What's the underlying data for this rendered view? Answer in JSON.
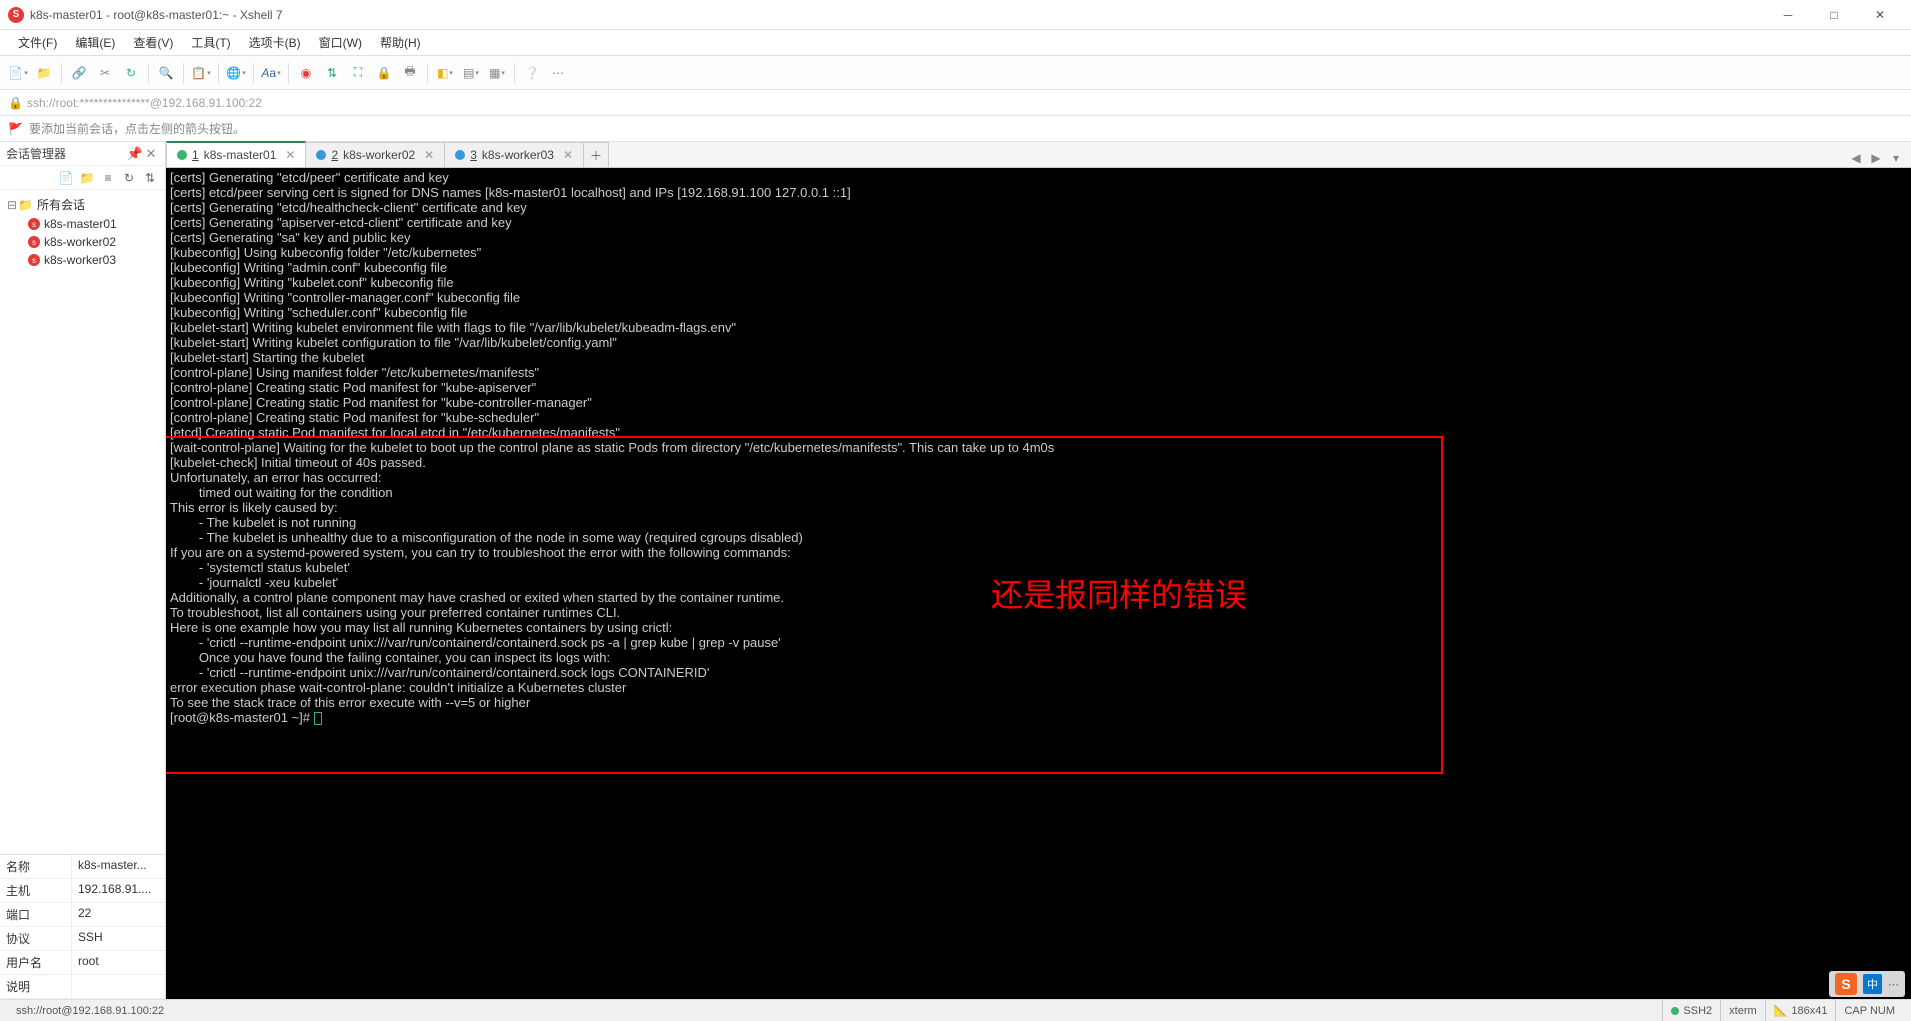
{
  "window": {
    "title": "k8s-master01 - root@k8s-master01:~ - Xshell 7"
  },
  "menu": [
    "文件(F)",
    "编辑(E)",
    "查看(V)",
    "工具(T)",
    "选项卡(B)",
    "窗口(W)",
    "帮助(H)"
  ],
  "address": "ssh://root:***************@192.168.91.100:22",
  "hint": "要添加当前会话，点击左侧的箭头按钮。",
  "sidebar": {
    "title": "会话管理器",
    "root": "所有会话",
    "items": [
      {
        "label": "k8s-master01"
      },
      {
        "label": "k8s-worker02"
      },
      {
        "label": "k8s-worker03"
      }
    ]
  },
  "props": [
    {
      "key": "名称",
      "val": "k8s-master..."
    },
    {
      "key": "主机",
      "val": "192.168.91...."
    },
    {
      "key": "端口",
      "val": "22"
    },
    {
      "key": "协议",
      "val": "SSH"
    },
    {
      "key": "用户名",
      "val": "root"
    },
    {
      "key": "说明",
      "val": ""
    }
  ],
  "tabs": [
    {
      "num": "1",
      "label": "k8s-master01",
      "active": true,
      "status": "green"
    },
    {
      "num": "2",
      "label": "k8s-worker02",
      "active": false,
      "status": "blue"
    },
    {
      "num": "3",
      "label": "k8s-worker03",
      "active": false,
      "status": "blue"
    }
  ],
  "annotation": "还是报同样的错误",
  "terminal": {
    "lines": [
      "[certs] Generating \"etcd/peer\" certificate and key",
      "[certs] etcd/peer serving cert is signed for DNS names [k8s-master01 localhost] and IPs [192.168.91.100 127.0.0.1 ::1]",
      "[certs] Generating \"etcd/healthcheck-client\" certificate and key",
      "[certs] Generating \"apiserver-etcd-client\" certificate and key",
      "[certs] Generating \"sa\" key and public key",
      "[kubeconfig] Using kubeconfig folder \"/etc/kubernetes\"",
      "[kubeconfig] Writing \"admin.conf\" kubeconfig file",
      "[kubeconfig] Writing \"kubelet.conf\" kubeconfig file",
      "[kubeconfig] Writing \"controller-manager.conf\" kubeconfig file",
      "[kubeconfig] Writing \"scheduler.conf\" kubeconfig file",
      "[kubelet-start] Writing kubelet environment file with flags to file \"/var/lib/kubelet/kubeadm-flags.env\"",
      "[kubelet-start] Writing kubelet configuration to file \"/var/lib/kubelet/config.yaml\"",
      "[kubelet-start] Starting the kubelet",
      "[control-plane] Using manifest folder \"/etc/kubernetes/manifests\"",
      "[control-plane] Creating static Pod manifest for \"kube-apiserver\"",
      "[control-plane] Creating static Pod manifest for \"kube-controller-manager\"",
      "[control-plane] Creating static Pod manifest for \"kube-scheduler\"",
      "[etcd] Creating static Pod manifest for local etcd in \"/etc/kubernetes/manifests\"",
      "[wait-control-plane] Waiting for the kubelet to boot up the control plane as static Pods from directory \"/etc/kubernetes/manifests\". This can take up to 4m0s",
      "[kubelet-check] Initial timeout of 40s passed.",
      "",
      "Unfortunately, an error has occurred:",
      "        timed out waiting for the condition",
      "",
      "This error is likely caused by:",
      "        - The kubelet is not running",
      "        - The kubelet is unhealthy due to a misconfiguration of the node in some way (required cgroups disabled)",
      "",
      "If you are on a systemd-powered system, you can try to troubleshoot the error with the following commands:",
      "        - 'systemctl status kubelet'",
      "        - 'journalctl -xeu kubelet'",
      "",
      "Additionally, a control plane component may have crashed or exited when started by the container runtime.",
      "To troubleshoot, list all containers using your preferred container runtimes CLI.",
      "Here is one example how you may list all running Kubernetes containers by using crictl:",
      "        - 'crictl --runtime-endpoint unix:///var/run/containerd/containerd.sock ps -a | grep kube | grep -v pause'",
      "        Once you have found the failing container, you can inspect its logs with:",
      "        - 'crictl --runtime-endpoint unix:///var/run/containerd/containerd.sock logs CONTAINERID'",
      "error execution phase wait-control-plane: couldn't initialize a Kubernetes cluster",
      "To see the stack trace of this error execute with --v=5 or higher"
    ],
    "prompt": "[root@k8s-master01 ~]# "
  },
  "status": {
    "conn": "ssh://root@192.168.91.100:22",
    "ssh": "SSH2",
    "term": "xterm",
    "size": "186x41",
    "extra": "CAP  NUM"
  },
  "tray": {
    "ch": "中"
  }
}
